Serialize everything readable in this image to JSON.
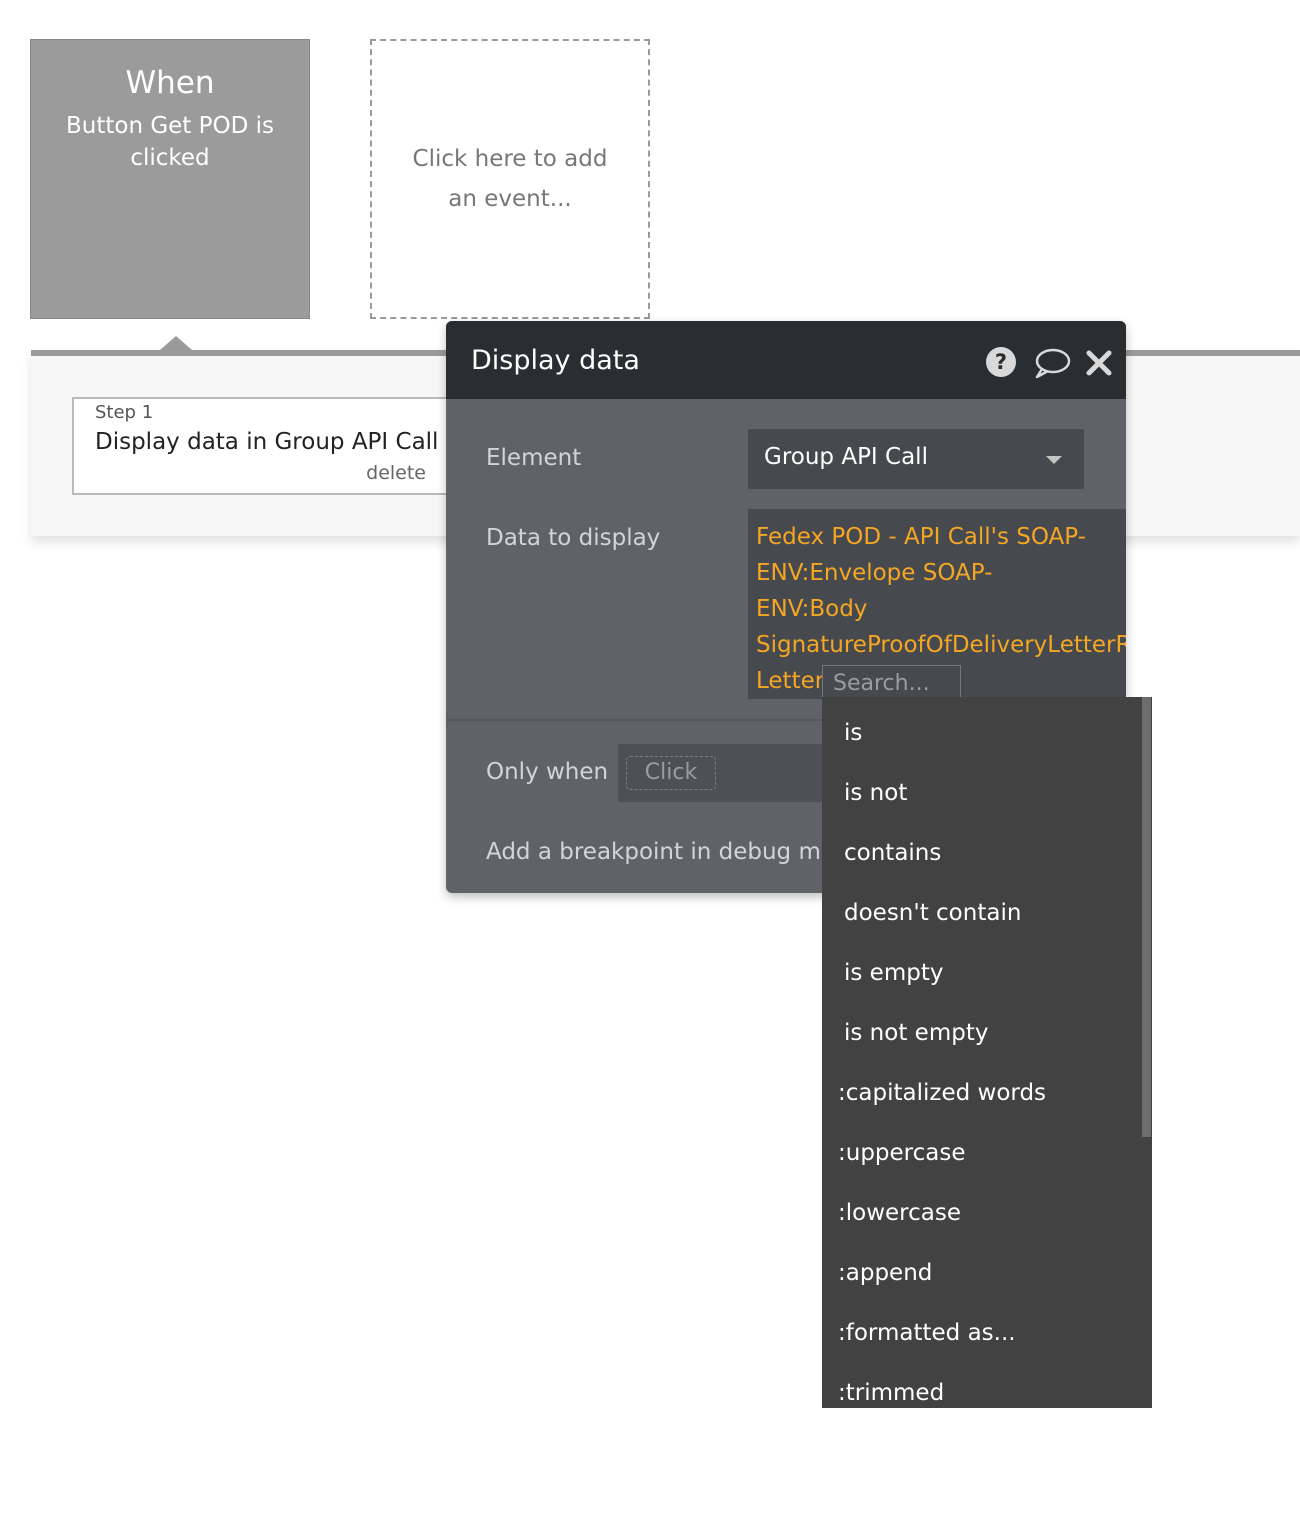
{
  "event_card": {
    "title": "When",
    "description": "Button Get POD is clicked"
  },
  "add_event": {
    "label": "Click here to add an event..."
  },
  "step": {
    "label": "Step 1",
    "title": "Display data in Group API Call",
    "delete_label": "delete"
  },
  "editor": {
    "title": "Display data",
    "icons": [
      "help-icon",
      "comment-icon",
      "close-icon"
    ],
    "element_label": "Element",
    "element_value": "Group API Call",
    "data_label": "Data to display",
    "data_expression": "Fedex POD - API Call's SOAP-\nENV:Envelope SOAP-\nENV:Body\nSignatureProofOfDeliveryLetterR\nLetter",
    "search_placeholder": "Search...",
    "only_when_label": "Only when",
    "only_when_value": "Click",
    "breakpoint_label": "Add a breakpoint in debug mo"
  },
  "dropdown": {
    "operators": [
      "is",
      "is not",
      "contains",
      "doesn't contain",
      "is empty",
      "is not empty"
    ],
    "functions": [
      ":capitalized words",
      ":uppercase",
      ":lowercase",
      ":append",
      ":formatted as...",
      ":trimmed"
    ]
  },
  "colors": {
    "expression": "#f5a623",
    "editor_bg": "#5f6368",
    "editor_header": "#2a2e31",
    "dropdown_bg": "#424242",
    "event_card": "#9b9b9b"
  }
}
